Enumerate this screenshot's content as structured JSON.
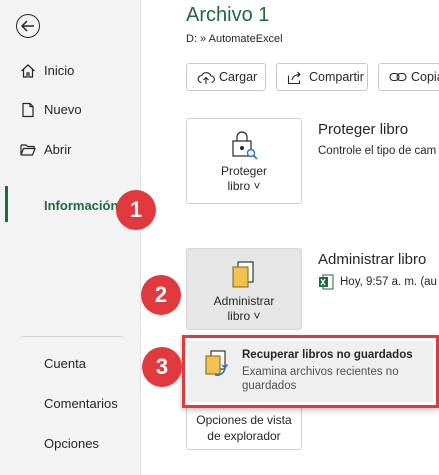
{
  "sidebar": {
    "items": [
      {
        "label": "Inicio",
        "icon": "home-icon"
      },
      {
        "label": "Nuevo",
        "icon": "new-document-icon"
      },
      {
        "label": "Abrir",
        "icon": "open-folder-icon"
      },
      {
        "label": "Información",
        "active": true
      },
      {
        "label": "Cuenta"
      },
      {
        "label": "Comentarios"
      },
      {
        "label": "Opciones"
      }
    ]
  },
  "header": {
    "title": "Archivo 1",
    "path": "D: » AutomateExcel"
  },
  "toolbar": {
    "upload_label": "Cargar",
    "share_label": "Compartir",
    "copy_label": "Copia"
  },
  "protect": {
    "card_line1": "Proteger",
    "card_line2": "libro ˅",
    "title": "Proteger libro",
    "desc": "Controle el tipo de cam"
  },
  "manage": {
    "card_line1": "Administrar",
    "card_line2": "libro ˅",
    "title": "Administrar libro",
    "entry": "Hoy, 9:57 a. m. (au"
  },
  "browser_view": {
    "card_line1": "Opciones de vista",
    "card_line2": "de explorador"
  },
  "flyout": {
    "title": "Recuperar libros no guardados",
    "desc": "Examina archivos recientes no guardados"
  },
  "badges": [
    "1",
    "2",
    "3"
  ],
  "colors": {
    "accent_green": "#1e6b3d",
    "annotation_red": "#e0393e"
  }
}
